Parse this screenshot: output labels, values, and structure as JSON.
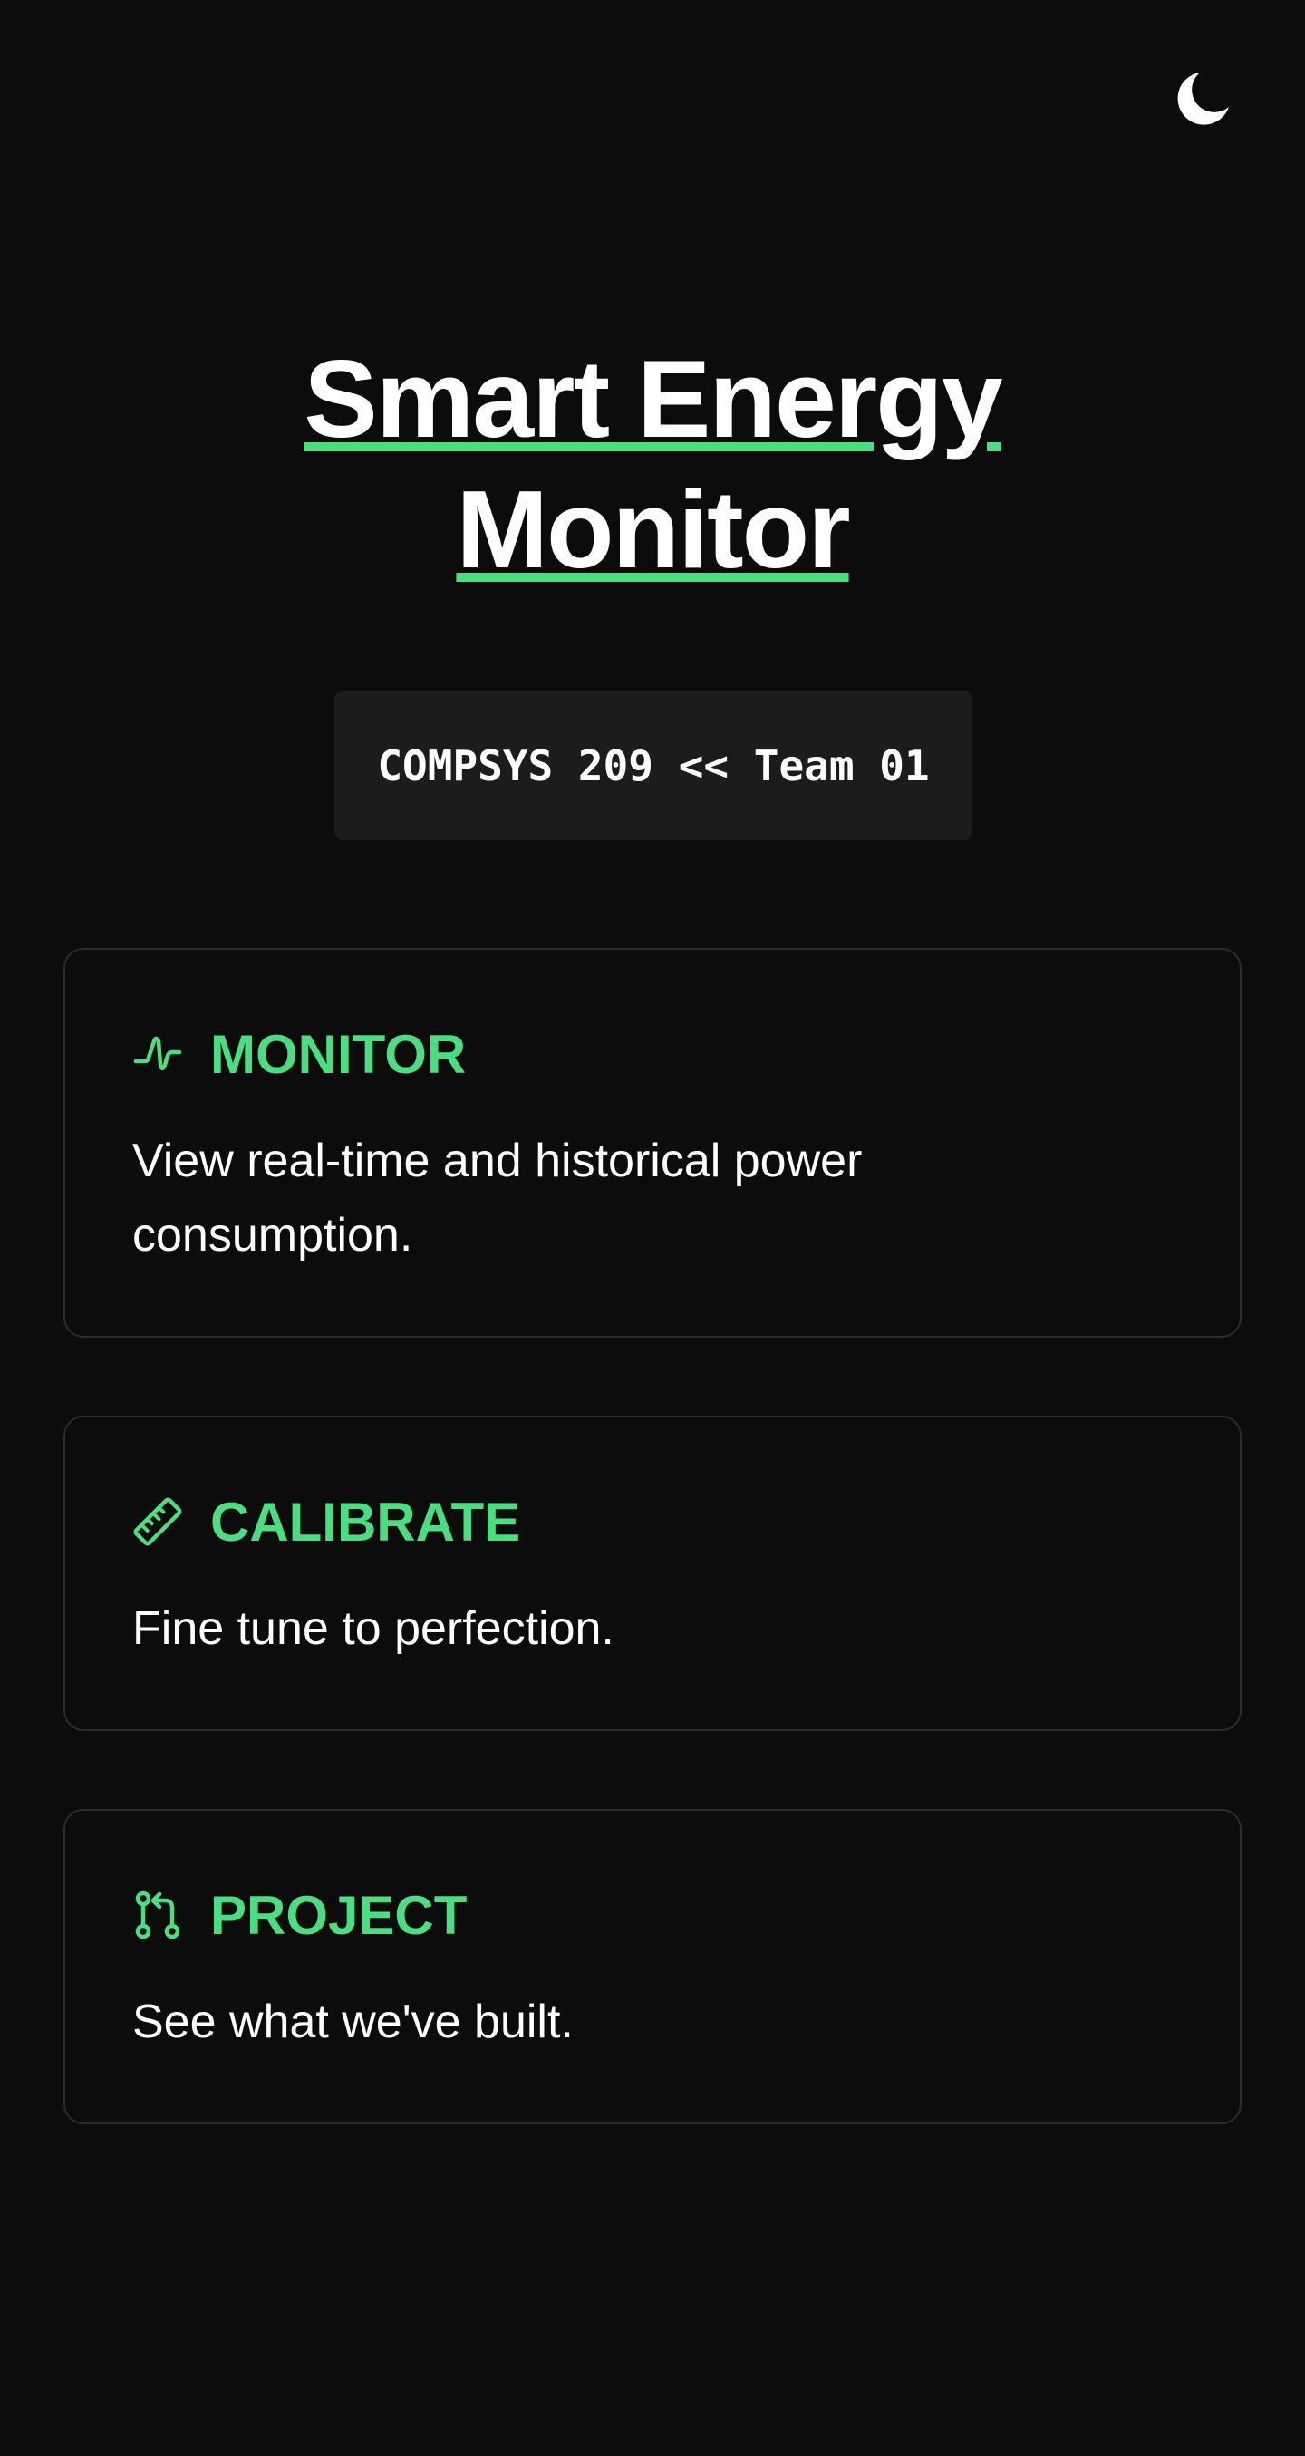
{
  "header": {
    "theme_toggle_icon": "moon-icon",
    "title_line1": "Smart Energy",
    "title_line2": "Monitor",
    "badge": "COMPSYS 209 << Team 01"
  },
  "colors": {
    "background": "#0c0c0c",
    "accent": "#4ade80",
    "card_border": "#2c2c2c",
    "badge_bg": "#1c1c1c",
    "text": "#ffffff"
  },
  "cards": [
    {
      "icon": "activity-wave-icon",
      "title": "MONITOR",
      "description": "View real-time and historical power consumption."
    },
    {
      "icon": "ruler-icon",
      "title": "CALIBRATE",
      "description": "Fine tune to perfection."
    },
    {
      "icon": "git-pull-request-icon",
      "title": "PROJECT",
      "description": "See what we've built."
    }
  ]
}
